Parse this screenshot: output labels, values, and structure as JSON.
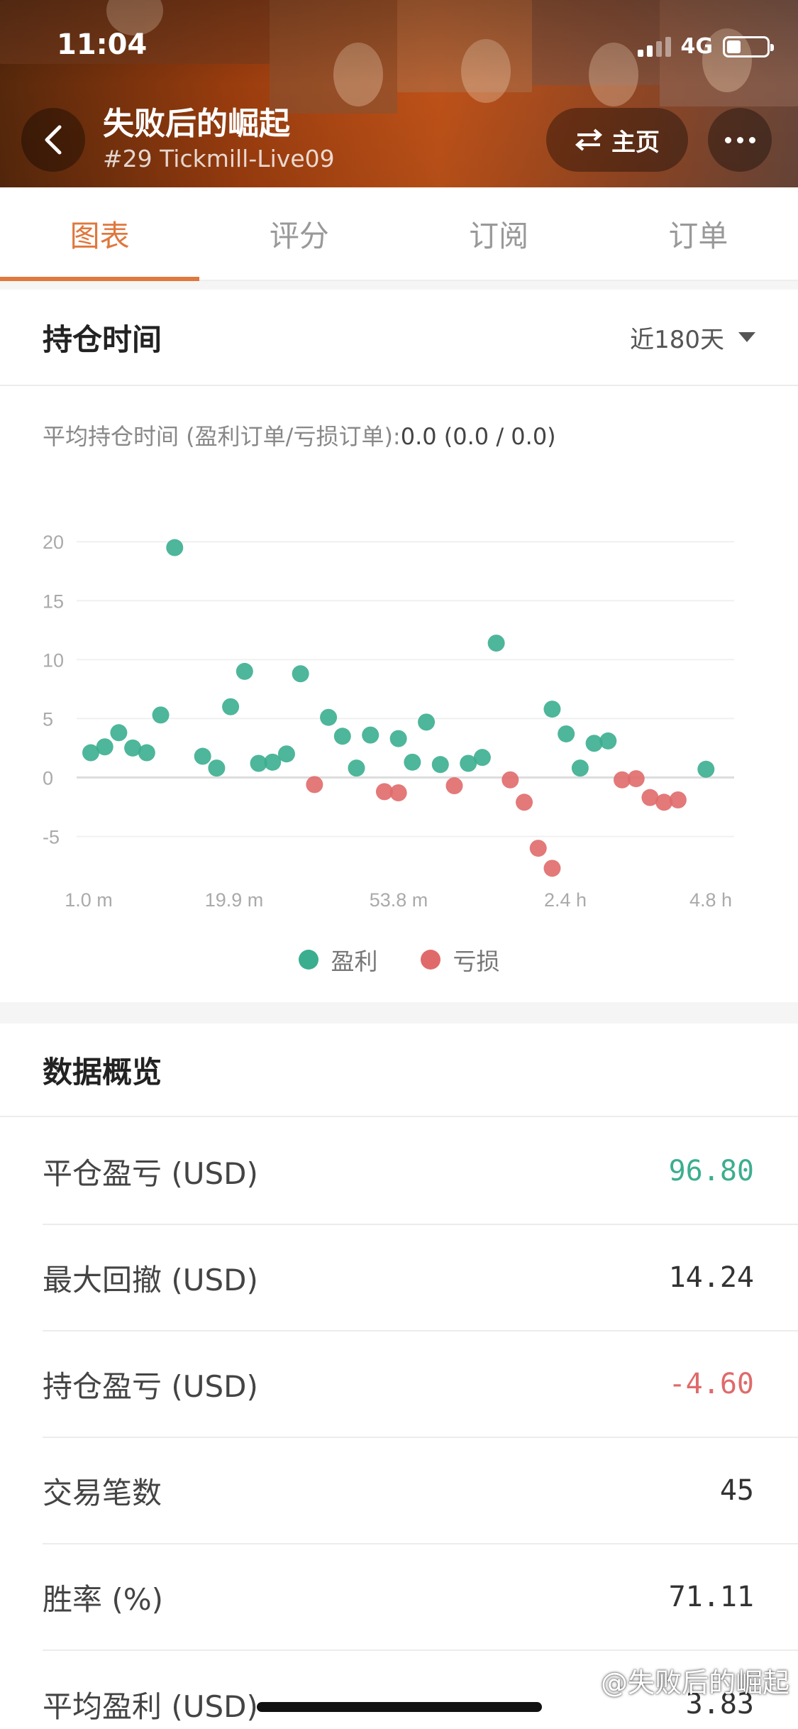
{
  "status_bar": {
    "time": "11:04",
    "network": "4G"
  },
  "header": {
    "title": "失败后的崛起",
    "subtitle": "#29 Tickmill-Live09",
    "home_label": "主页"
  },
  "tabs": [
    {
      "label": "图表",
      "active": true
    },
    {
      "label": "评分",
      "active": false
    },
    {
      "label": "订阅",
      "active": false
    },
    {
      "label": "订单",
      "active": false
    }
  ],
  "holding": {
    "title": "持仓时间",
    "period": "近180天",
    "avg_label": "平均持仓时间 (盈利订单/亏损订单):",
    "avg_value": "0.0 (0.0 / 0.0)"
  },
  "colors": {
    "profit": "#3bae8f",
    "loss": "#e06a6a",
    "accent": "#e0773d"
  },
  "chart_data": {
    "type": "scatter",
    "title": "",
    "xlabel": "",
    "ylabel": "",
    "ylim": [
      -7.5,
      22
    ],
    "yticks": [
      20,
      15,
      10,
      5,
      0,
      -5
    ],
    "xticks": [
      "1.0 m",
      "19.9 m",
      "53.8 m",
      "2.4 h",
      "4.8 h"
    ],
    "grid": true,
    "legend": "bottom-center",
    "series": [
      {
        "name": "盈利",
        "color": "#3bae8f",
        "x": [
          1,
          2,
          3,
          4,
          5,
          6,
          7,
          9,
          10,
          11,
          12,
          13,
          14,
          15,
          16,
          18,
          19,
          20,
          21,
          23,
          24,
          25,
          26,
          28,
          29,
          30,
          34,
          35,
          36,
          37,
          38,
          45
        ],
        "y": [
          2.1,
          2.6,
          3.8,
          2.5,
          2.1,
          5.3,
          19.5,
          1.8,
          0.8,
          6.0,
          9.0,
          1.2,
          1.3,
          2.0,
          8.8,
          5.1,
          3.5,
          0.8,
          3.6,
          3.3,
          1.3,
          4.7,
          1.1,
          1.2,
          1.7,
          11.4,
          5.8,
          3.7,
          0.8,
          2.9,
          3.1,
          0.7
        ]
      },
      {
        "name": "亏损",
        "color": "#e06a6a",
        "x": [
          17,
          22,
          23,
          27,
          31,
          32,
          33,
          34,
          39,
          40,
          41,
          42,
          43
        ],
        "y": [
          -0.6,
          -1.2,
          -1.3,
          -0.7,
          -0.2,
          -2.1,
          -6.0,
          -7.7,
          -0.2,
          -0.1,
          -1.7,
          -2.1,
          -1.9
        ]
      }
    ]
  },
  "overview": {
    "title": "数据概览",
    "rows": [
      {
        "label": "平仓盈亏 (USD)",
        "value": "96.80"
      },
      {
        "label": "最大回撤 (USD)",
        "value": "14.24"
      },
      {
        "label": "持仓盈亏 (USD)",
        "value": "-4.60"
      },
      {
        "label": "交易笔数",
        "value": "45"
      },
      {
        "label": "胜率 (%)",
        "value": "71.11"
      },
      {
        "label": "平均盈利 (USD)",
        "value": "3.83"
      }
    ]
  },
  "watermark": "@失败后的崛起"
}
